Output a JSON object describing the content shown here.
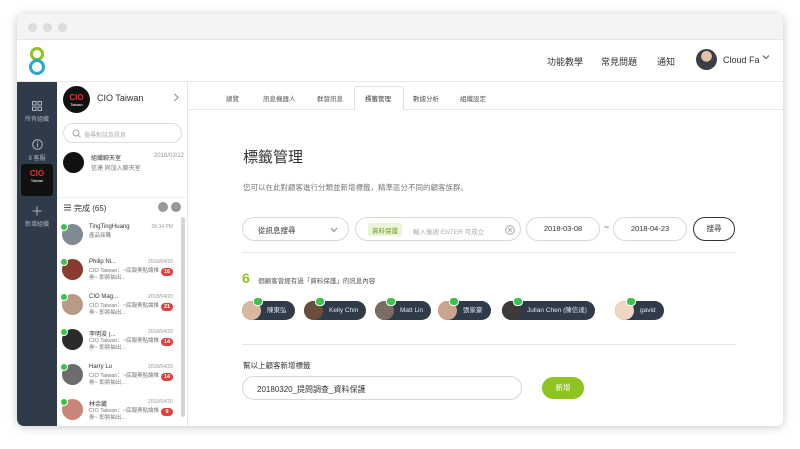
{
  "header": {
    "nav": [
      "功能教學",
      "常見問題",
      "通知"
    ],
    "username": "Cloud Fa"
  },
  "leftnav": {
    "items": [
      {
        "label": "所有組織",
        "icon": "grid-icon"
      },
      {
        "label": "8 客服",
        "icon": "info-icon"
      },
      {
        "label": "新增組織",
        "icon": "plus-icon"
      }
    ],
    "active_logo": "CIO",
    "active_logo_sub": "Taiwan"
  },
  "convlist": {
    "brand_logo": "CIO",
    "brand_logo_sub": "Taiwan",
    "brand_name": "CIO Taiwan",
    "search_placeholder": "搜尋對話及訊息",
    "group": {
      "title": "組織聊天室",
      "time": "2018/03/12",
      "sub": "信達 同加入聊天室"
    },
    "done_label": "完成 (65)",
    "items": [
      {
        "name": "TingTingHuang",
        "time": "06:34 PM",
        "preview": "產品採購",
        "count": "",
        "color": "#7f8a93"
      },
      {
        "name": "Philip Ni...",
        "time": "2018/04/20",
        "preview": "CIO Taiwan：~底報奧點論推券~ 即將抽出...",
        "count": "16",
        "color": "#8a3a2e"
      },
      {
        "name": "CIO Mag...",
        "time": "2018/04/20",
        "preview": "CIO Taiwan：~底報奧點論推券~ 即將抽出...",
        "count": "21",
        "color": "#b89a86"
      },
      {
        "name": "李明浚 (...",
        "time": "2018/04/20",
        "preview": "CIO Taiwan：~底報奧點論推券~ 即將抽出...",
        "count": "14",
        "color": "#2b2b2b"
      },
      {
        "name": "Harry Lu",
        "time": "2018/04/20",
        "preview": "CIO Taiwan：~底報奧點論推券~ 即將抽出...",
        "count": "14",
        "color": "#6c6c6c"
      },
      {
        "name": "林余葳",
        "time": "2018/04/20",
        "preview": "CIO Taiwan：~底報奧點論推券~ 即將抽出...",
        "count": "9",
        "color": "#c9857a"
      }
    ]
  },
  "tabs": [
    "總覽",
    "訊息機器人",
    "群發訊息",
    "標籤管理",
    "數據分析",
    "組織設定"
  ],
  "active_tab": "標籤管理",
  "main": {
    "title": "標籤管理",
    "description": "您可以在此對顧客進行分類並新增標籤，精準區分不同的顧客族群。",
    "filter_select": "從訊息搜尋",
    "tag_chip": "資料保護",
    "tag_placeholder": "輸入後按 ENTER 可成立",
    "date_from": "2018-03-08",
    "date_sep": "~",
    "date_to": "2018-04-23",
    "search_button": "搜尋",
    "count": "6",
    "count_text": "個顧客曾經有過「資料保護」的訊息內容",
    "people": [
      "陳東弘",
      "Kelly Chin",
      "Matt Lin",
      "張家豪",
      "Julian Chen (陳信達)",
      "gavid"
    ],
    "add_tag_label": "幫以上顧客新增標籤",
    "add_tag_value": "20180320_提問調查_資料保護",
    "add_button": "新增"
  },
  "colors": {
    "accent": "#8fc31f",
    "sidebar": "#2f3b48",
    "badge": "#e2403e",
    "line": "#3ac34a"
  }
}
